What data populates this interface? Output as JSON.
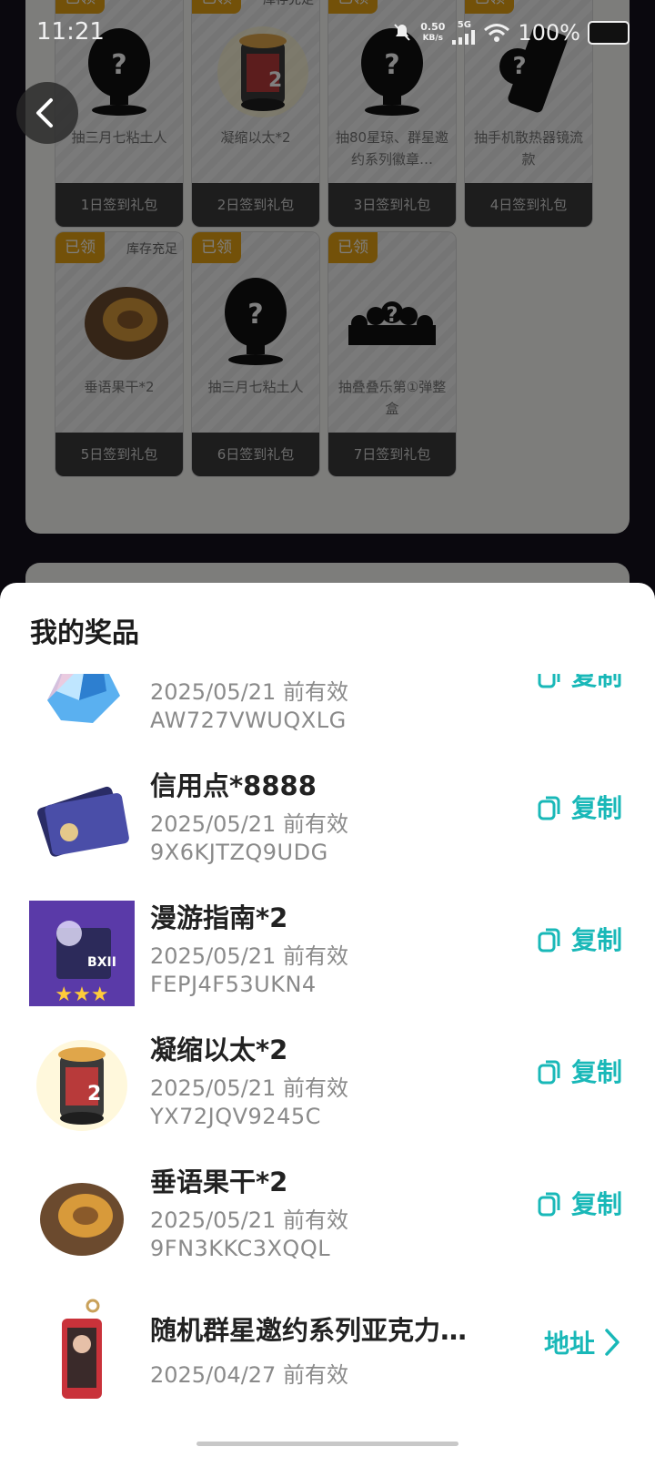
{
  "status_bar": {
    "time": "11:21",
    "net_speed_value": "0.50",
    "net_speed_unit": "KB/s",
    "network_type": "5G",
    "battery": "100%"
  },
  "gifts": [
    {
      "tag": "已领",
      "stock": "",
      "name": "抽三月七粘土人",
      "label": "1日签到礼包",
      "icon": "silhouette-figure-icon"
    },
    {
      "tag": "已领",
      "stock": "库存充足",
      "name": "凝缩以太*2",
      "label": "2日签到礼包",
      "icon": "ether-canister-icon"
    },
    {
      "tag": "已领",
      "stock": "",
      "name": "抽80星琼、群星邀约系列徽章…",
      "label": "3日签到礼包",
      "icon": "silhouette-figure-icon"
    },
    {
      "tag": "已领",
      "stock": "",
      "name": "抽手机散热器镜流款",
      "label": "4日签到礼包",
      "icon": "silhouette-device-icon"
    },
    {
      "tag": "已领",
      "stock": "库存充足",
      "name": "垂语果干*2",
      "label": "5日签到礼包",
      "icon": "dried-fruit-icon"
    },
    {
      "tag": "已领",
      "stock": "",
      "name": "抽三月七粘土人",
      "label": "6日签到礼包",
      "icon": "silhouette-figure-icon"
    },
    {
      "tag": "已领",
      "stock": "",
      "name": "抽叠叠乐第①弹整盒",
      "label": "7日签到礼包",
      "icon": "silhouette-group-icon"
    }
  ],
  "sheet": {
    "title": "我的奖品",
    "prizes": [
      {
        "title": "",
        "date": "2025/05/21 前有效",
        "code": "AW727VWUQXLG",
        "action": "复制",
        "action_type": "copy",
        "icon": "crystal-icon"
      },
      {
        "title": "信用点*8888",
        "date": "2025/05/21 前有效",
        "code": "9X6KJTZQ9UDG",
        "action": "复制",
        "action_type": "copy",
        "icon": "credit-card-icon"
      },
      {
        "title": "漫游指南*2",
        "date": "2025/05/21 前有效",
        "code": "FEPJ4F53UKN4",
        "action": "复制",
        "action_type": "copy",
        "icon": "travel-guide-icon"
      },
      {
        "title": "凝缩以太*2",
        "date": "2025/05/21 前有效",
        "code": "YX72JQV9245C",
        "action": "复制",
        "action_type": "copy",
        "icon": "ether-canister-icon"
      },
      {
        "title": "垂语果干*2",
        "date": "2025/05/21 前有效",
        "code": "9FN3KKC3XQQL",
        "action": "复制",
        "action_type": "copy",
        "icon": "dried-fruit-icon"
      },
      {
        "title": "随机群星邀约系列亚克力流…",
        "date": "2025/04/27 前有效",
        "code": "",
        "action": "地址",
        "action_type": "address",
        "icon": "acrylic-keychain-icon"
      }
    ]
  },
  "colors": {
    "accent": "#19b8b8",
    "tag": "#e7a312"
  }
}
